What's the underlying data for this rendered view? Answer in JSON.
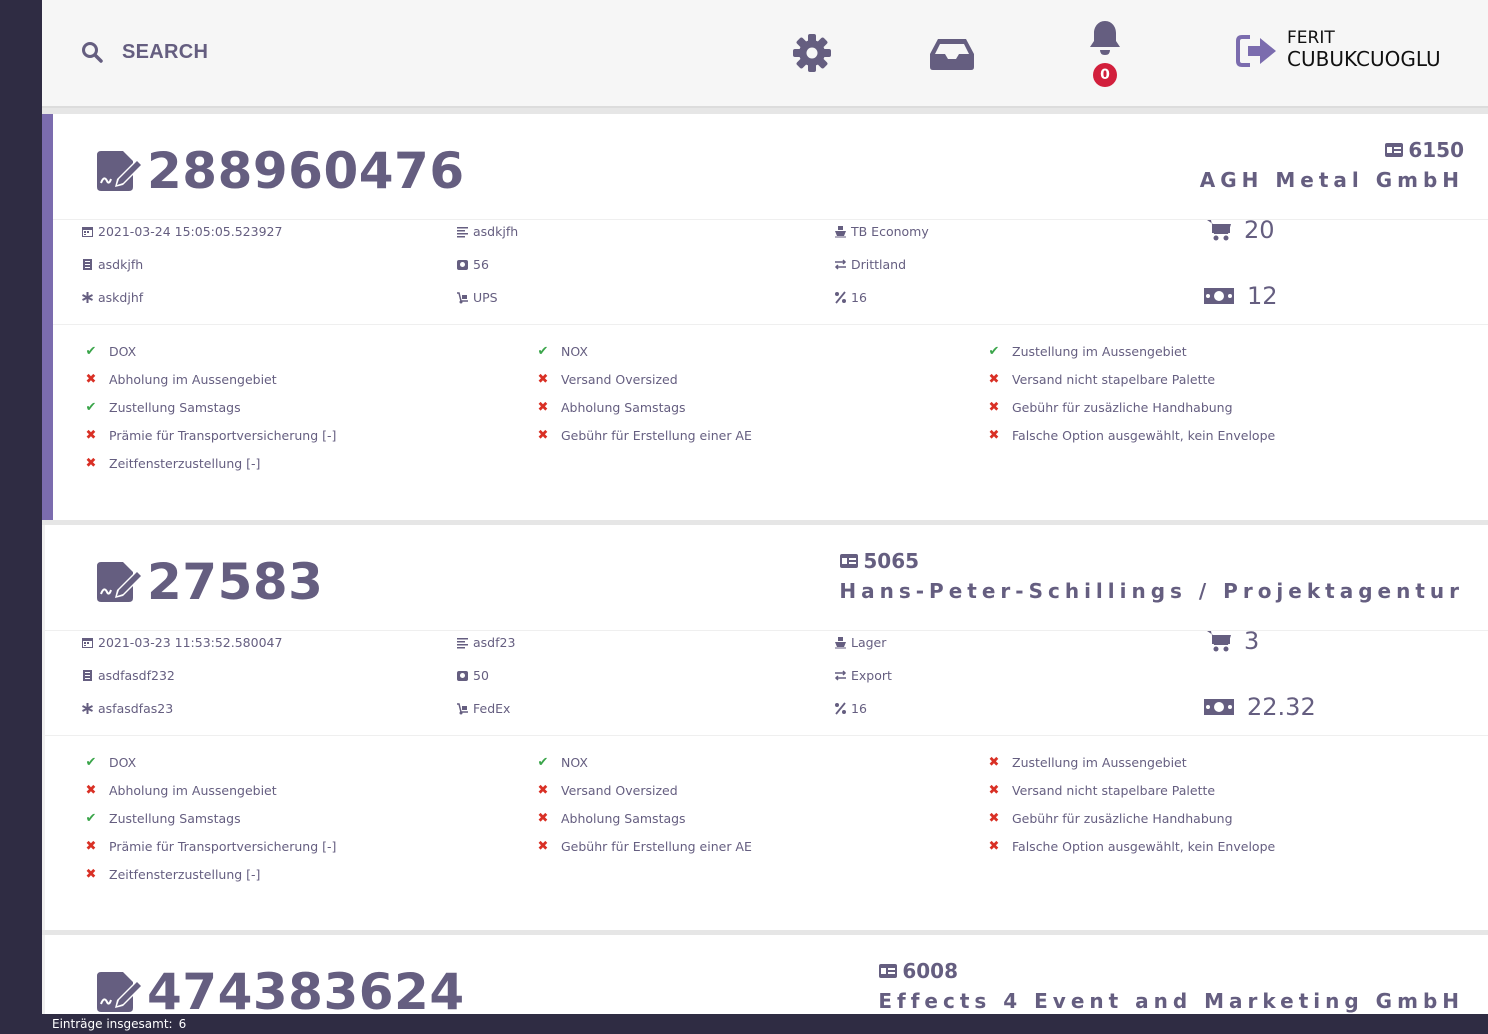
{
  "topbar": {
    "search_label": "SEARCH",
    "notification_count": "0",
    "user_first": "FERIT",
    "user_last": "CUBUKCUOGLU"
  },
  "cards": [
    {
      "order_number": "288960476",
      "customer_id": "6150",
      "customer_name": "AGH Metal GmbH",
      "date": "2021-03-24 15:05:05.523927",
      "ref1": "asdkjfh",
      "ref2": "askdjhf",
      "list_text": "asdkjfh",
      "weight": "56",
      "carrier": "UPS",
      "service": "TB Economy",
      "zone": "Drittland",
      "tax": "16",
      "cart_count": "20",
      "amount": "12",
      "options": [
        [
          {
            "label": "DOX",
            "ok": true
          },
          {
            "label": "Abholung im Aussengebiet",
            "ok": false
          },
          {
            "label": "Zustellung Samstags",
            "ok": true
          },
          {
            "label": "Prämie für Transportversicherung [-]",
            "ok": false
          },
          {
            "label": "Zeitfensterzustellung [-]",
            "ok": false
          }
        ],
        [
          {
            "label": "NOX",
            "ok": true
          },
          {
            "label": "Versand Oversized",
            "ok": false
          },
          {
            "label": "Abholung Samstags",
            "ok": false
          },
          {
            "label": "Gebühr für Erstellung einer AE",
            "ok": false
          }
        ],
        [
          {
            "label": "Zustellung im Aussengebiet",
            "ok": true
          },
          {
            "label": "Versand nicht stapelbare Palette",
            "ok": false
          },
          {
            "label": "Gebühr für zusäzliche Handhabung",
            "ok": false
          },
          {
            "label": "Falsche Option ausgewählt, kein Envelope",
            "ok": false
          }
        ]
      ]
    },
    {
      "order_number": "27583",
      "customer_id": "5065",
      "customer_name": "Hans-Peter-Schillings / Projektagentur",
      "date": "2021-03-23 11:53:52.580047",
      "ref1": "asdfasdf232",
      "ref2": "asfasdfas23",
      "list_text": "asdf23",
      "weight": "50",
      "carrier": "FedEx",
      "service": "Lager",
      "zone": "Export",
      "tax": "16",
      "cart_count": "3",
      "amount": "22.32",
      "options": [
        [
          {
            "label": "DOX",
            "ok": true
          },
          {
            "label": "Abholung im Aussengebiet",
            "ok": false
          },
          {
            "label": "Zustellung Samstags",
            "ok": true
          },
          {
            "label": "Prämie für Transportversicherung [-]",
            "ok": false
          },
          {
            "label": "Zeitfensterzustellung [-]",
            "ok": false
          }
        ],
        [
          {
            "label": "NOX",
            "ok": true
          },
          {
            "label": "Versand Oversized",
            "ok": false
          },
          {
            "label": "Abholung Samstags",
            "ok": false
          },
          {
            "label": "Gebühr für Erstellung einer AE",
            "ok": false
          }
        ],
        [
          {
            "label": "Zustellung im Aussengebiet",
            "ok": false
          },
          {
            "label": "Versand nicht stapelbare Palette",
            "ok": false
          },
          {
            "label": "Gebühr für zusäzliche Handhabung",
            "ok": false
          },
          {
            "label": "Falsche Option ausgewählt, kein Envelope",
            "ok": false
          }
        ]
      ]
    },
    {
      "order_number": "474383624",
      "customer_id": "6008",
      "customer_name": "Effects 4 Event and Marketing GmbH"
    }
  ],
  "footer": {
    "label": "Einträge insgesamt:",
    "count": "6"
  },
  "colors": {
    "accent": "#7b6cae",
    "text": "#655e80",
    "sidebar": "#2f2c43",
    "ok": "#3aa54a",
    "not_ok": "#d93025",
    "badge": "#d21f3c"
  }
}
